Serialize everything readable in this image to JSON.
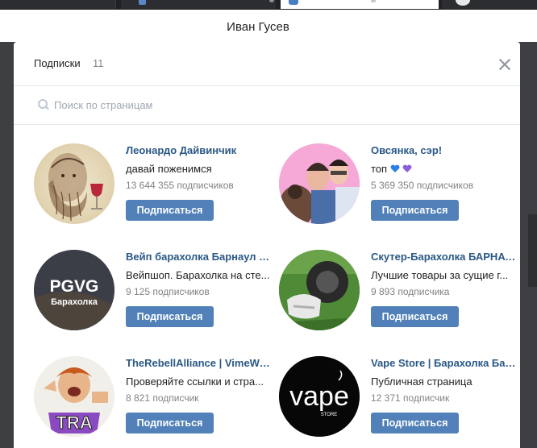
{
  "page": {
    "user_name": "Иван Гусев"
  },
  "modal": {
    "title": "Подписки",
    "count": "11",
    "search_placeholder": "Поиск по страницам"
  },
  "communities": [
    {
      "name": "Леонардо Дайвинчик",
      "description": "давай поженимся",
      "subscribers": "13 644 355 подписчиков",
      "button": "Подписаться",
      "avatar_icon": "leonardo-portrait"
    },
    {
      "name": "Овсянка, сэр!",
      "description": "топ",
      "description_emoji_colors": [
        "#2b7de9",
        "#8c5fd8"
      ],
      "subscribers": "5 369 350 подписчиков",
      "button": "Подписаться",
      "avatar_icon": "group-photo"
    },
    {
      "name": "Вейп барахолка Барнаул | ...",
      "description": "Вейпшоп. Барахолка на сте...",
      "subscribers": "9 125 подписчиков",
      "button": "Подписаться",
      "avatar_icon": "pgvg-logo",
      "avatar_text": [
        "PGVG",
        "Барахолка"
      ]
    },
    {
      "name": "Скутер-Барахолка БАРНАУ...",
      "description": "Лучшие товары за сущие г...",
      "subscribers": "9 893 подписчика",
      "button": "Подписаться",
      "avatar_icon": "scooter-photo"
    },
    {
      "name": "TheRebellAlliance | VimeWo...",
      "description": "Проверяйте ссылки и стра...",
      "subscribers": "8 821 подписчик",
      "button": "Подписаться",
      "avatar_icon": "tra-logo",
      "avatar_text": [
        "TRA"
      ]
    },
    {
      "name": "Vape Store | Барахолка Бар...",
      "description": "Публичная страница",
      "subscribers": "12 371 подписчик",
      "button": "Подписаться",
      "avatar_icon": "vape-store-logo",
      "avatar_text": [
        "vape",
        "STORE"
      ]
    }
  ],
  "colors": {
    "accent": "#5181b8",
    "link": "#2a5885",
    "muted": "#828282"
  }
}
